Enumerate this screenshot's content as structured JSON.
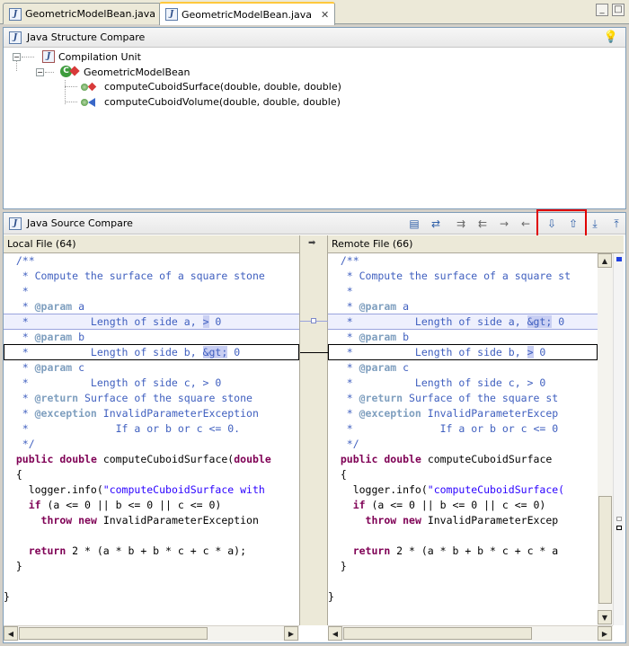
{
  "tabs": [
    {
      "label": "GeometricModelBean.java",
      "active": false
    },
    {
      "label": "GeometricModelBean.java",
      "active": true
    }
  ],
  "structure": {
    "title": "Java Structure Compare",
    "tree": {
      "root": "Compilation Unit",
      "class": "GeometricModelBean",
      "methods": [
        {
          "label": "computeCuboidSurface(double, double, double)",
          "icon": "method-changed-icon"
        },
        {
          "label": "computeCuboidVolume(double, double, double)",
          "icon": "method-added-icon"
        }
      ]
    }
  },
  "source": {
    "title": "Java Source Compare",
    "local_header": "Local File (64)",
    "remote_header": "Remote File (66)",
    "local_lines": [
      "  /**",
      "   * Compute the surface of a square stone",
      "   *",
      "   * @param a",
      "   *          Length of side a, > 0",
      "   * @param b",
      "   *          Length of side b, &gt; 0",
      "   * @param c",
      "   *          Length of side c, > 0",
      "   * @return Surface of the square stone",
      "   * @exception InvalidParameterException",
      "   *              If a or b or c <= 0.",
      "   */",
      "  public double computeCuboidSurface(double",
      "  {",
      "    logger.info(\"computeCuboidSurface with",
      "    if (a <= 0 || b <= 0 || c <= 0)",
      "      throw new InvalidParameterException",
      "",
      "    return 2 * (a * b + b * c + c * a);",
      "  }",
      "",
      "}"
    ],
    "remote_lines": [
      "  /**",
      "   * Compute the surface of a square st",
      "   *",
      "   * @param a",
      "   *          Length of side a, &gt; 0",
      "   * @param b",
      "   *          Length of side b, > 0",
      "   * @param c",
      "   *          Length of side c, > 0",
      "   * @return Surface of the square st",
      "   * @exception InvalidParameterExcep",
      "   *              If a or b or c <= 0",
      "   */",
      "  public double computeCuboidSurface",
      "  {",
      "    logger.info(\"computeCuboidSurface(",
      "    if (a <= 0 || b <= 0 || c <= 0)",
      "      throw new InvalidParameterExcep",
      "",
      "    return 2 * (a * b + b * c + c * a",
      "  }",
      "",
      "}"
    ]
  },
  "colors": {
    "comment": "#3f5fbf",
    "javadoc_tag": "#7f9fbf",
    "keyword": "#7f0055",
    "string": "#2a00ff",
    "highlight_box": "#e00000"
  }
}
